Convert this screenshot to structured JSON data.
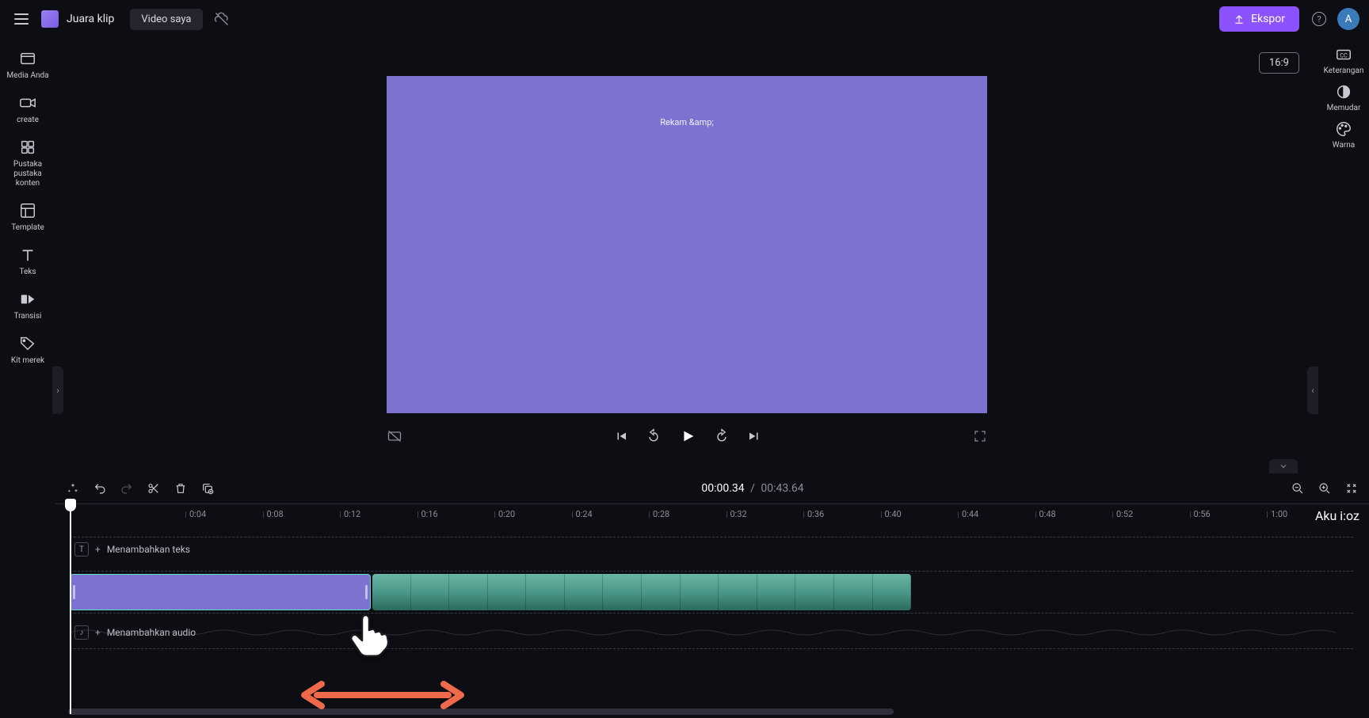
{
  "header": {
    "brand": "Juara klip",
    "project_pill": "Video saya",
    "export_label": "Ekspor",
    "avatar_letter": "A"
  },
  "left_rail": {
    "items": [
      {
        "label": "Media Anda"
      },
      {
        "label": "create"
      },
      {
        "label": "Pustaka pustaka konten"
      },
      {
        "label": "Template"
      },
      {
        "label": "Teks"
      },
      {
        "label": "Transisi"
      },
      {
        "label": "Kit merek"
      }
    ]
  },
  "right_rail": {
    "items": [
      {
        "label": "Keterangan"
      },
      {
        "label": "Memudar"
      },
      {
        "label": "Warna"
      }
    ]
  },
  "stage": {
    "aspect": "16:9",
    "caption": "Rekam &amp;"
  },
  "timeline": {
    "current": "00:00.34",
    "sep": "/",
    "duration": "00:43.64",
    "ticks": [
      "0:04",
      "0:08",
      "0:12",
      "0:16",
      "0:20",
      "0:24",
      "0:28",
      "0:32",
      "0:36",
      "0:40",
      "0:44",
      "0:48",
      "0:52",
      "0:56",
      "1:00"
    ],
    "right_label": "Aku i:oz"
  },
  "tracks": {
    "text_add": "Menambahkan teks",
    "audio_add": "Menambahkan audio"
  }
}
